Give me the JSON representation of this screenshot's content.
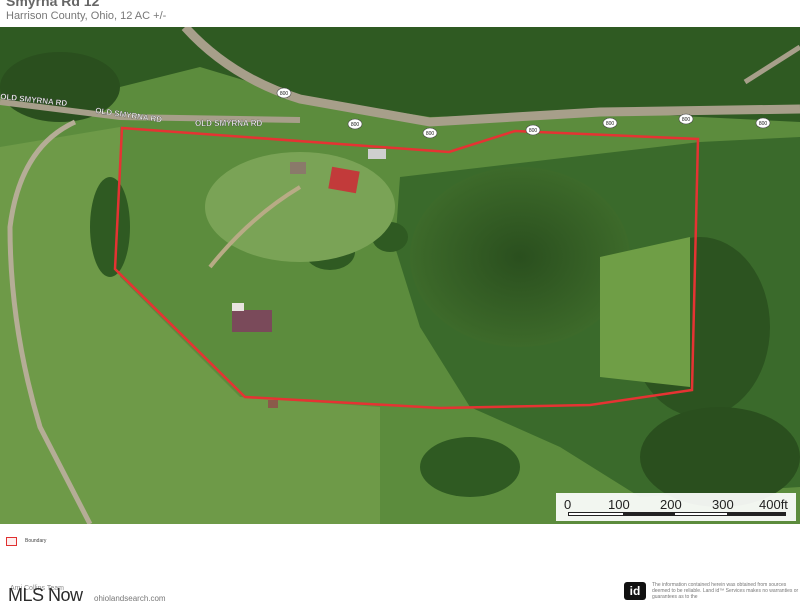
{
  "header": {
    "title": "Smyrna Rd 12",
    "subtitle": "Harrison County, Ohio, 12 AC +/-"
  },
  "map": {
    "road_labels": [
      "OLD SMYRNA RD",
      "OLD SMYRNA RD",
      "OLD SMYRNA RD"
    ],
    "route_shield": "800",
    "boundary_color": "#e53333",
    "road_color": "#a79f8a",
    "vegetation_dark": "#2f5a22",
    "vegetation_light": "#5f8f3e",
    "roof_color": "#c23a3a"
  },
  "scale": {
    "labels": [
      "0",
      "100",
      "200",
      "300",
      "400ft"
    ]
  },
  "legend": {
    "label": "Boundary"
  },
  "footer": {
    "agent": "Ami Collins Team",
    "logo_text": "MLS Now",
    "url": "ohiolandsearch.com",
    "id_logo": "id",
    "disclaimer": "The information contained herein was obtained from sources deemed to be reliable. Land id™ Services makes no warranties or guarantees as to the"
  }
}
